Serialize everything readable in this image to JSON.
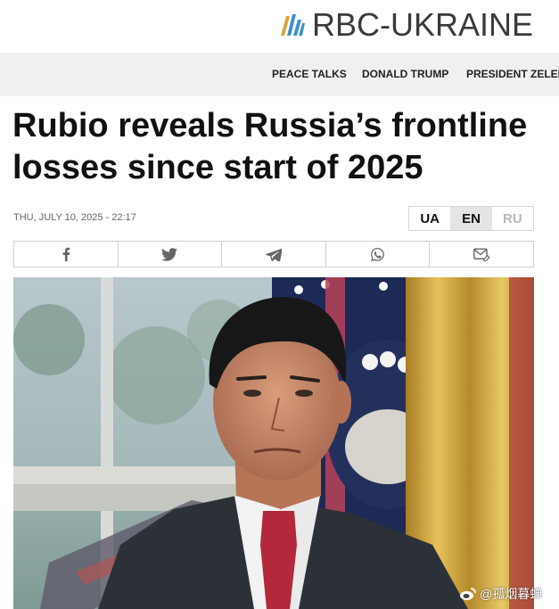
{
  "site": {
    "name": "RBC-UKRAINE",
    "logo_icon": "rbc-ukraine-logo-mark"
  },
  "nav": {
    "items": [
      {
        "label": "PEACE TALKS"
      },
      {
        "label": "DONALD TRUMP"
      },
      {
        "label": "PRESIDENT ZELENS"
      }
    ]
  },
  "article": {
    "headline": "Rubio reveals Russia’s frontline losses since start of 2025",
    "dateline": "THU, JULY 10, 2025 - 22:17",
    "photo_icon": "article-photo"
  },
  "languages": {
    "items": [
      {
        "label": "UA",
        "state": "default"
      },
      {
        "label": "EN",
        "state": "selected"
      },
      {
        "label": "RU",
        "state": "disabled"
      }
    ]
  },
  "share": {
    "icons": [
      "facebook-icon",
      "twitter-icon",
      "telegram-icon",
      "whatsapp-icon",
      "email-icon"
    ]
  },
  "watermark": {
    "text": "@孤烟暮蝉",
    "icon": "weibo-icon"
  },
  "colors": {
    "logo_blue": "#3f8fcf",
    "logo_gold": "#d9a63a",
    "nav_background": "#eef0f2",
    "selected_language": "#e2e4e6",
    "inactive_language": "#b7b7b7"
  }
}
